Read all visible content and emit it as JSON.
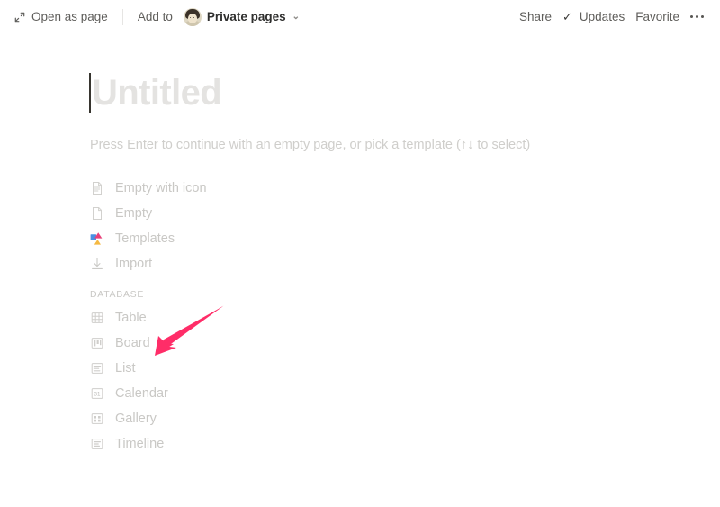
{
  "toolbar": {
    "open_as_page": "Open as page",
    "open_as_page_icon": "expand-diagonal-icon",
    "add_to": "Add to",
    "workspace": "Private pages",
    "workspace_avatar": "user-avatar",
    "chevron": "⌄",
    "share": "Share",
    "updates": "Updates",
    "updates_check": "✓",
    "favorite": "Favorite",
    "more": "more-options"
  },
  "page": {
    "title_placeholder": "Untitled",
    "hint": "Press Enter to continue with an empty page, or pick a template (↑↓ to select)"
  },
  "options": [
    {
      "label": "Empty with icon",
      "icon": "page-with-lines-icon"
    },
    {
      "label": "Empty",
      "icon": "blank-page-icon"
    },
    {
      "label": "Templates",
      "icon": "templates-shapes-icon"
    },
    {
      "label": "Import",
      "icon": "download-arrow-icon"
    }
  ],
  "database": {
    "section_label": "DATABASE",
    "items": [
      {
        "label": "Table",
        "icon": "table-grid-icon"
      },
      {
        "label": "Board",
        "icon": "board-columns-icon"
      },
      {
        "label": "List",
        "icon": "list-lines-icon"
      },
      {
        "label": "Calendar",
        "icon": "calendar-31-icon"
      },
      {
        "label": "Gallery",
        "icon": "gallery-squares-icon"
      },
      {
        "label": "Timeline",
        "icon": "timeline-icon"
      }
    ]
  },
  "annotation": {
    "arrow_color": "#FF2D68",
    "points_at": "Table"
  },
  "colors": {
    "background": "#FFFFFF",
    "text_muted": "#C9C8C5",
    "title_placeholder": "#E4E3E1",
    "toolbar_text": "#5F5E5B",
    "accent_pink": "#FF2D68"
  }
}
